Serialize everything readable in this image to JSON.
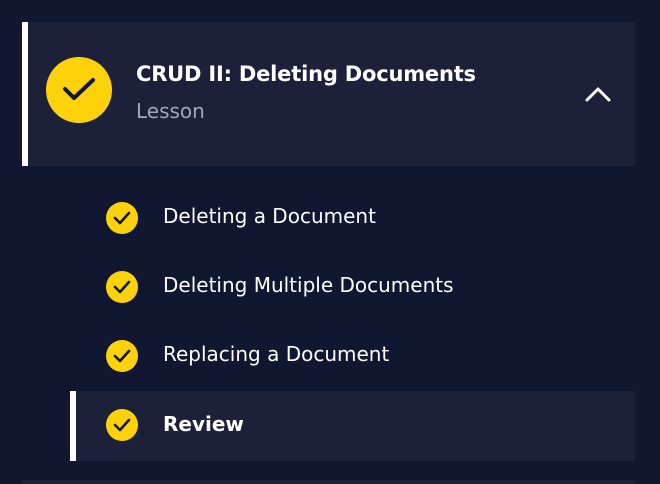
{
  "lesson": {
    "title": "CRUD II: Deleting Documents",
    "type": "Lesson",
    "status_icon": "check-circle-icon",
    "toggle_icon": "chevron-up-icon",
    "completed": true,
    "expanded": true
  },
  "modules": [
    {
      "label": "Deleting a Document",
      "completed": true,
      "active": false
    },
    {
      "label": "Deleting Multiple Documents",
      "completed": true,
      "active": false
    },
    {
      "label": "Replacing a Document",
      "completed": true,
      "active": false
    },
    {
      "label": "Review",
      "completed": true,
      "active": true
    }
  ],
  "colors": {
    "background": "#111631",
    "card": "#1c2139",
    "accent": "#fed20a",
    "text": "#ffffff",
    "muted_text": "#a2a6b8"
  }
}
